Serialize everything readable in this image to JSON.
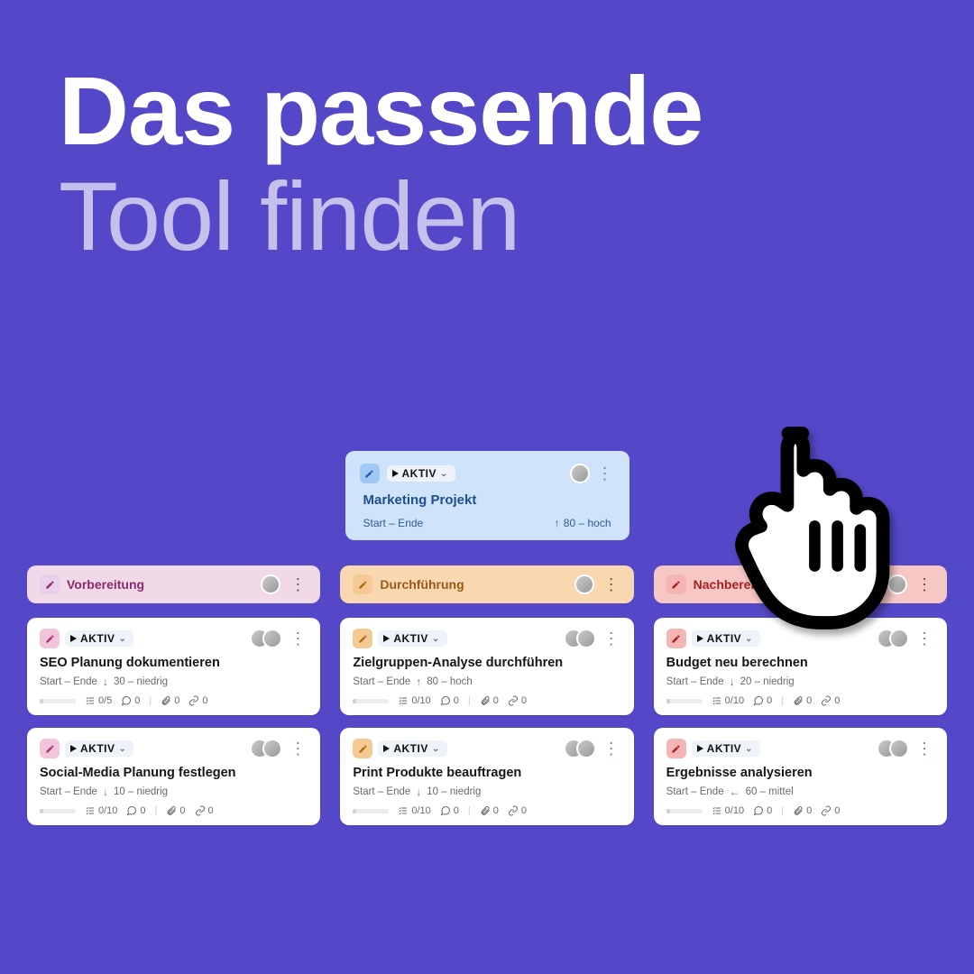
{
  "hero": {
    "line1": "Das passende",
    "line2": "Tool finden"
  },
  "parent": {
    "status": "AKTIV",
    "title": "Marketing Projekt",
    "range": "Start – Ende",
    "priority_arrow": "↑",
    "priority": "80 – hoch"
  },
  "columns": [
    {
      "color": "purple",
      "label": "Vorbereitung",
      "tasks": [
        {
          "badge": "pink",
          "status": "AKTIV",
          "title": "SEO Planung dokumentieren",
          "range": "Start – Ende",
          "arrow": "↓",
          "priority": "30 – niedrig",
          "checklist": "0/5",
          "comments": "0",
          "attachments": "0",
          "links": "0"
        },
        {
          "badge": "pink",
          "status": "AKTIV",
          "title": "Social-Media Planung festlegen",
          "range": "Start – Ende",
          "arrow": "↓",
          "priority": "10 – niedrig",
          "checklist": "0/10",
          "comments": "0",
          "attachments": "0",
          "links": "0"
        }
      ]
    },
    {
      "color": "orange",
      "label": "Durchführung",
      "tasks": [
        {
          "badge": "orange",
          "status": "AKTIV",
          "title": "Zielgruppen-Analyse durchführen",
          "range": "Start – Ende",
          "arrow": "↑",
          "priority": "80 – hoch",
          "checklist": "0/10",
          "comments": "0",
          "attachments": "0",
          "links": "0"
        },
        {
          "badge": "orange",
          "status": "AKTIV",
          "title": "Print Produkte beauftragen",
          "range": "Start – Ende",
          "arrow": "↓",
          "priority": "10 – niedrig",
          "checklist": "0/10",
          "comments": "0",
          "attachments": "0",
          "links": "0"
        }
      ]
    },
    {
      "color": "red",
      "label": "Nachbereitung",
      "tasks": [
        {
          "badge": "red",
          "status": "AKTIV",
          "title": "Budget neu berechnen",
          "range": "Start – Ende",
          "arrow": "↓",
          "priority": "20 – niedrig",
          "checklist": "0/10",
          "comments": "0",
          "attachments": "0",
          "links": "0"
        },
        {
          "badge": "red",
          "status": "AKTIV",
          "title": "Ergebnisse analysieren",
          "range": "Start – Ende",
          "arrow": "←",
          "priority": "60 – mittel",
          "checklist": "0/10",
          "comments": "0",
          "attachments": "0",
          "links": "0"
        }
      ]
    }
  ]
}
